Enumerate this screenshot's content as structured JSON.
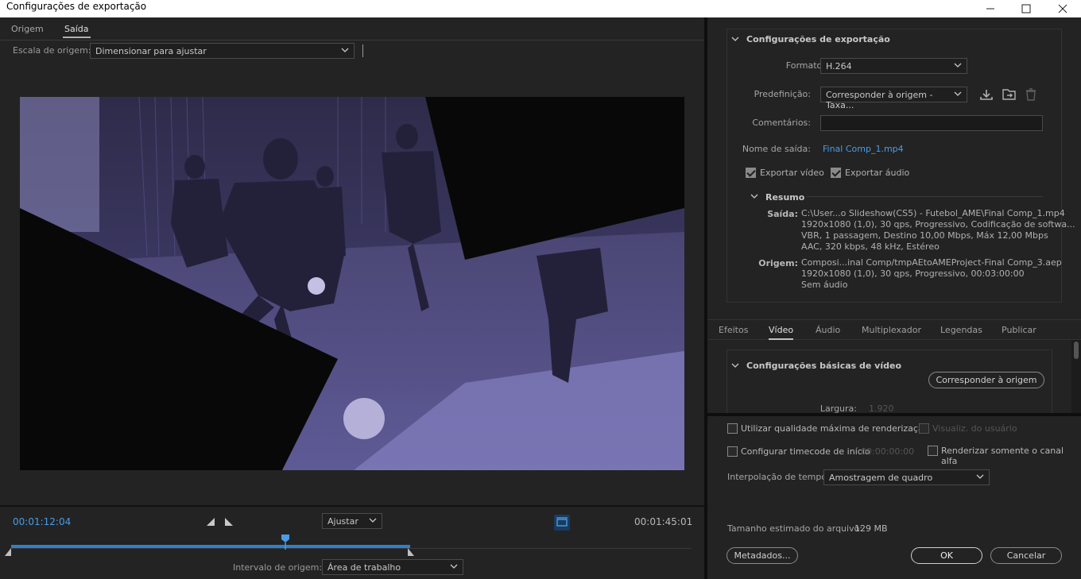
{
  "window": {
    "title": "Configurações de exportação"
  },
  "left": {
    "tabs": [
      "Origem",
      "Saída"
    ],
    "active_tab": "Saída",
    "scale_label": "Escala de origem:",
    "scale_value": "Dimensionar para ajustar",
    "timecode_current": "00:01:12:04",
    "timecode_end": "00:01:45:01",
    "zoom_value": "Ajustar",
    "range_label": "Intervalo de origem:",
    "range_value": "Área de trabalho",
    "playhead_fraction": 0.687
  },
  "export_settings": {
    "title": "Configurações de exportação",
    "format_label": "Formato:",
    "format_value": "H.264",
    "preset_label": "Predefinição:",
    "preset_value": "Corresponder à origem - Taxa...",
    "comments_label": "Comentários:",
    "comments_value": "",
    "output_label": "Nome de saída:",
    "output_value": "Final Comp_1.mp4",
    "export_video_label": "Exportar vídeo",
    "export_video_checked": true,
    "export_audio_label": "Exportar áudio",
    "export_audio_checked": true,
    "summary_title": "Resumo",
    "summary_output_label": "Saída:",
    "summary_output_lines": [
      "C:\\User...o Slideshow(CS5) - Futebol_AME\\Final Comp_1.mp4",
      "1920x1080 (1,0), 30 qps, Progressivo, Codificação de softwa...",
      "VBR, 1 passagem, Destino 10,00 Mbps, Máx 12,00 Mbps",
      "AAC, 320 kbps, 48 kHz, Estéreo"
    ],
    "summary_source_label": "Origem:",
    "summary_source_lines": [
      "Composi...inal Comp/tmpAEtoAMEProject-Final Comp_3.aep",
      "1920x1080 (1,0), 30 qps, Progressivo, 00:03:00:00",
      "Sem áudio"
    ]
  },
  "right_tabs": [
    "Efeitos",
    "Vídeo",
    "Áudio",
    "Multiplexador",
    "Legendas",
    "Publicar"
  ],
  "active_right_tab": "Vídeo",
  "video_basic": {
    "title": "Configurações básicas de vídeo",
    "match_button": "Corresponder à origem",
    "width_label": "Largura:",
    "width_value": "1.920"
  },
  "bottom": {
    "max_quality_label": "Utilizar qualidade máxima de renderização",
    "user_preview_label": "Visualiz. do usuário",
    "start_timecode_label": "Configurar timecode de início",
    "start_timecode_value": "00:00:00:00",
    "alpha_only_label": "Renderizar somente o canal alfa",
    "time_interp_label": "Interpolação de tempo:",
    "time_interp_value": "Amostragem de quadro",
    "file_size_label": "Tamanho estimado do arquivo:",
    "file_size_value": "129 MB",
    "metadata_button": "Metadados...",
    "ok_button": "OK",
    "cancel_button": "Cancelar"
  },
  "colors": {
    "accent": "#4a9be8",
    "track": "#2d80c9",
    "tint": "#5c5890"
  }
}
